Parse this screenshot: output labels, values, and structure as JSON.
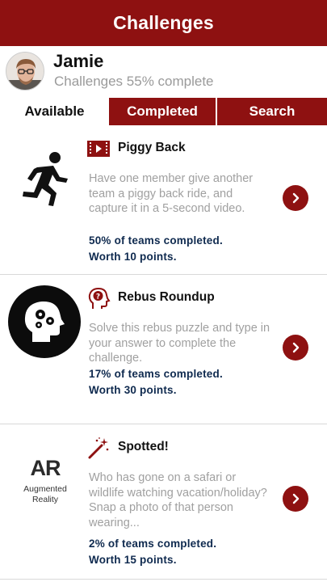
{
  "header": {
    "title": "Challenges"
  },
  "profile": {
    "name": "Jamie",
    "progress_text": "Challenges 55% complete",
    "avatar_icon": "user-avatar-photo"
  },
  "tabs": [
    {
      "label": "Available",
      "active": true
    },
    {
      "label": "Completed",
      "active": false
    },
    {
      "label": "Search",
      "active": false
    }
  ],
  "challenges": [
    {
      "title": "Piggy Back",
      "type_icon": "video-icon",
      "thumbnail_icon": "running-person-icon",
      "description": "Have one member give another team a piggy back ride, and capture it in a 5-second video.",
      "stats_completed": "50% of teams completed.",
      "stats_points": "Worth 10 points."
    },
    {
      "title": "Rebus Roundup",
      "type_icon": "question-head-icon",
      "thumbnail_icon": "brain-gears-icon",
      "description": "Solve this rebus puzzle and type in your answer to complete the challenge.",
      "stats_completed": "17% of teams completed.",
      "stats_points": "Worth 30 points."
    },
    {
      "title": "Spotted!",
      "type_icon": "magic-wand-icon",
      "thumbnail_icon": "augmented-reality-icon",
      "thumbnail_text": "AR",
      "thumbnail_caption_line1": "Augmented",
      "thumbnail_caption_line2": "Reality",
      "description": "Who has gone on a safari or wildlife watching vacation/holiday? Snap a photo of that person wearing...",
      "stats_completed": "2% of teams completed.",
      "stats_points": "Worth 15 points."
    }
  ],
  "colors": {
    "brand": "#8e1111",
    "stats": "#0f2a4f",
    "muted": "#9a9a9a"
  }
}
